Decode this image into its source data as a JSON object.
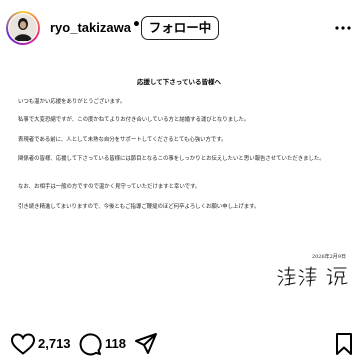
{
  "header": {
    "username": "ryo_takizawa",
    "separator": "•",
    "follow_label": "フォロー中",
    "more_icon": "more-dots-icon",
    "avatar_icon": "avatar"
  },
  "post": {
    "title": "応援して下さっている皆様へ",
    "paragraphs": [
      "いつも温かい応援をありがとうございます。",
      "私事で大変恐縮ですが、この度かねてよりお付き合いしている方と結婚する運びとなりました。",
      "表現者である前に、人として未熟な自分をサポートしてくださるとても心強い方です。",
      "関係者の皆様、応援して下さっている皆様には節目となるこの事をしっかりとお伝えしたいと思い報告させていただきました。",
      "なお、お相手は一般の方ですので温かく見守っていただけますと幸いです。",
      "引き続き精進してまいりますので、今後ともご指導ご鞭撻のほど何卒よろしくお願い申し上げます。"
    ],
    "date": "2026年2月9日",
    "signature": "滝沢 諒"
  },
  "actions": {
    "like_icon": "heart-icon",
    "like_count": "2,713",
    "comment_icon": "comment-icon",
    "comment_count": "118",
    "share_icon": "share-icon",
    "save_icon": "bookmark-icon"
  }
}
